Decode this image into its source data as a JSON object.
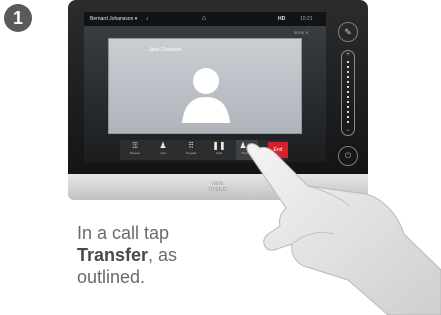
{
  "step": {
    "number": "1"
  },
  "status_bar": {
    "caller": "Bernard Johansson",
    "home_icon": "home-icon",
    "hd": "HD",
    "clock": "10:21"
  },
  "call": {
    "timer": "00:00",
    "remote_name": "Jane Davidson"
  },
  "controls": {
    "items": [
      {
        "icon": "present-icon",
        "label": "Present"
      },
      {
        "icon": "add-person-icon",
        "label": "Add"
      },
      {
        "icon": "keypad-icon",
        "label": "Keypad"
      },
      {
        "icon": "pause-icon",
        "label": "Hold"
      },
      {
        "icon": "transfer-icon",
        "label": "Transfer"
      }
    ],
    "end_label": "End"
  },
  "device": {
    "brand": "CISCO"
  },
  "caption": {
    "line1": "In a call tap",
    "bold": "Transfer",
    "line2_rest": ", as",
    "line3": "outlined."
  },
  "colors": {
    "end": "#d6202a",
    "accent": "#7fb8ea"
  }
}
